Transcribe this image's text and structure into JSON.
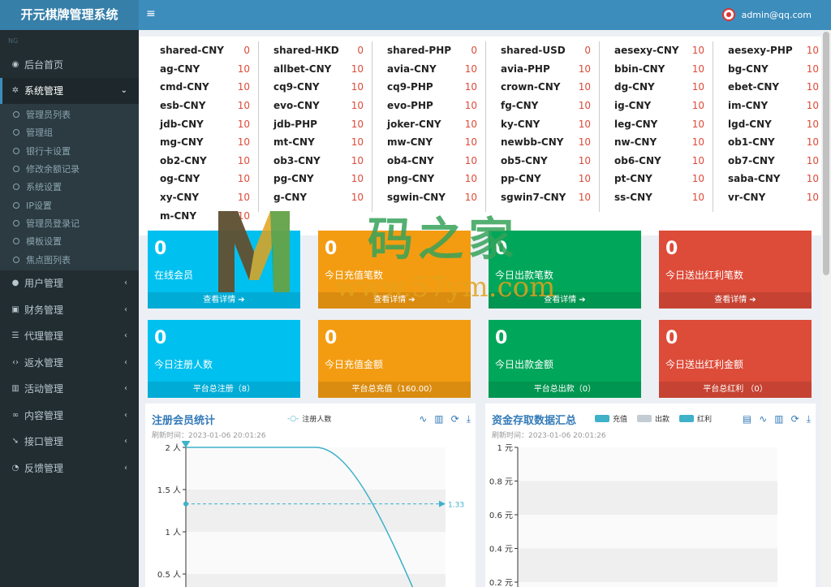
{
  "app": {
    "title": "开元棋牌管理系统",
    "menu_toggle": "≡",
    "user": "admin@qq.com"
  },
  "sidebar": {
    "header": "NG",
    "items": [
      {
        "icon": "dashboard-icon",
        "glyph": "◉",
        "label": "后台首页"
      },
      {
        "icon": "gear-icon",
        "glyph": "✲",
        "label": "系统管理",
        "caret": "⌄",
        "active": true,
        "children": [
          "管理员列表",
          "管理组",
          "银行卡设置",
          "修改余额记录",
          "系统设置",
          "IP设置",
          "管理员登录记",
          "模板设置",
          "焦点图列表"
        ]
      },
      {
        "icon": "users-icon",
        "glyph": "●",
        "label": "用户管理",
        "caret": "‹"
      },
      {
        "icon": "money-icon",
        "glyph": "▣",
        "label": "财务管理",
        "caret": "‹"
      },
      {
        "icon": "list-icon",
        "glyph": "☰",
        "label": "代理管理",
        "caret": "‹"
      },
      {
        "icon": "code-icon",
        "glyph": "‹›",
        "label": "返水管理",
        "caret": "‹"
      },
      {
        "icon": "map-icon",
        "glyph": "▥",
        "label": "活动管理",
        "caret": "‹"
      },
      {
        "icon": "link-icon",
        "glyph": "∞",
        "label": "内容管理",
        "caret": "‹"
      },
      {
        "icon": "plug-icon",
        "glyph": "➘",
        "label": "接口管理",
        "caret": "‹"
      },
      {
        "icon": "comment-icon",
        "glyph": "◔",
        "label": "反馈管理",
        "caret": "‹"
      }
    ]
  },
  "games": [
    [
      [
        "shared-CNY",
        "0"
      ],
      [
        "ag-CNY",
        "10"
      ],
      [
        "cmd-CNY",
        "10"
      ],
      [
        "esb-CNY",
        "10"
      ],
      [
        "jdb-CNY",
        "10"
      ],
      [
        "mg-CNY",
        "10"
      ],
      [
        "ob2-CNY",
        "10"
      ],
      [
        "og-CNY",
        "10"
      ],
      [
        "xy-CNY",
        "10"
      ],
      [
        "m-CNY",
        "10"
      ]
    ],
    [
      [
        "shared-HKD",
        "0"
      ],
      [
        "allbet-CNY",
        "10"
      ],
      [
        "cq9-CNY",
        "10"
      ],
      [
        "evo-CNY",
        "10"
      ],
      [
        "jdb-PHP",
        "10"
      ],
      [
        "mt-CNY",
        "10"
      ],
      [
        "ob3-CNY",
        "10"
      ],
      [
        "pg-CNY",
        "10"
      ],
      [
        "g-CNY",
        "10"
      ]
    ],
    [
      [
        "shared-PHP",
        "0"
      ],
      [
        "avia-CNY",
        "10"
      ],
      [
        "cq9-PHP",
        "10"
      ],
      [
        "evo-PHP",
        "10"
      ],
      [
        "joker-CNY",
        "10"
      ],
      [
        "mw-CNY",
        "10"
      ],
      [
        "ob4-CNY",
        "10"
      ],
      [
        "png-CNY",
        "10"
      ],
      [
        "sgwin-CNY",
        "10"
      ]
    ],
    [
      [
        "shared-USD",
        "0"
      ],
      [
        "avia-PHP",
        "10"
      ],
      [
        "crown-CNY",
        "10"
      ],
      [
        "fg-CNY",
        "10"
      ],
      [
        "ky-CNY",
        "10"
      ],
      [
        "newbb-CNY",
        "10"
      ],
      [
        "ob5-CNY",
        "10"
      ],
      [
        "pp-CNY",
        "10"
      ],
      [
        "sgwin7-CNY",
        "10"
      ]
    ],
    [
      [
        "aesexy-CNY",
        "10"
      ],
      [
        "bbin-CNY",
        "10"
      ],
      [
        "dg-CNY",
        "10"
      ],
      [
        "ig-CNY",
        "10"
      ],
      [
        "leg-CNY",
        "10"
      ],
      [
        "nw-CNY",
        "10"
      ],
      [
        "ob6-CNY",
        "10"
      ],
      [
        "pt-CNY",
        "10"
      ],
      [
        "ss-CNY",
        "10"
      ]
    ],
    [
      [
        "aesexy-PHP",
        "10"
      ],
      [
        "bg-CNY",
        "10"
      ],
      [
        "ebet-CNY",
        "10"
      ],
      [
        "im-CNY",
        "10"
      ],
      [
        "lgd-CNY",
        "10"
      ],
      [
        "ob1-CNY",
        "10"
      ],
      [
        "ob7-CNY",
        "10"
      ],
      [
        "saba-CNY",
        "10"
      ],
      [
        "vr-CNY",
        "10"
      ]
    ]
  ],
  "cards": [
    {
      "value": "0",
      "label": "在线会员",
      "footer": "查看详情",
      "footer_icon": "➔",
      "color": "aqua"
    },
    {
      "value": "0",
      "label": "今日充值笔数",
      "footer": "查看详情",
      "footer_icon": "➔",
      "color": "yellow"
    },
    {
      "value": "0",
      "label": "今日出款笔数",
      "footer": "查看详情",
      "footer_icon": "➔",
      "color": "green"
    },
    {
      "value": "0",
      "label": "今日送出红利笔数",
      "footer": "查看详情",
      "footer_icon": "➔",
      "color": "red"
    },
    {
      "value": "0",
      "label": "今日注册人数",
      "footer": "平台总注册（8）",
      "color": "aqua"
    },
    {
      "value": "0",
      "label": "今日充值金额",
      "footer": "平台总充值（160.00）",
      "color": "yellow"
    },
    {
      "value": "0",
      "label": "今日出款金额",
      "footer": "平台总出款（0）",
      "color": "green"
    },
    {
      "value": "0",
      "label": "今日送出红利金额",
      "footer": "平台总红利 （0）",
      "color": "red"
    }
  ],
  "panel_left": {
    "title": "注册会员统计",
    "refresh": "刷新时间：2023-01-06 20:01:26",
    "legend": "注册人数",
    "tools": [
      "∿",
      "▥",
      "⟳",
      "⤓"
    ],
    "pin_label": "2",
    "avg_label": "1.33",
    "yticks": [
      "2 人",
      "1.5 人",
      "1 人",
      "0.5 人"
    ]
  },
  "panel_right": {
    "title": "资金存取数据汇总",
    "refresh": "刷新时间：2023-01-06 20:01:26",
    "legend": [
      {
        "label": "充值",
        "color": "#3fb1c9"
      },
      {
        "label": "出款",
        "color": "#c4ccd3"
      },
      {
        "label": "红利",
        "color": "#3fb1c9"
      }
    ],
    "tools": [
      "▤",
      "∿",
      "▥",
      "⟳",
      "⤓"
    ],
    "yticks": [
      "1 元",
      "0.8 元",
      "0.6 元",
      "0.4 元",
      "0.2 元"
    ]
  },
  "chart_data": [
    {
      "type": "line",
      "title": "注册会员统计",
      "series": [
        {
          "name": "注册人数",
          "values": [
            2,
            2,
            2,
            0
          ]
        }
      ],
      "mark_point": {
        "label": "2",
        "value": 2
      },
      "mark_line": {
        "label": "1.33",
        "value": 1.33
      },
      "ylim": [
        0,
        2
      ],
      "y_ticks": [
        "2 人",
        "1.5 人",
        "1 人",
        "0.5 人"
      ],
      "grid": true
    },
    {
      "type": "bar",
      "title": "资金存取数据汇总",
      "series": [
        {
          "name": "充值",
          "values": []
        },
        {
          "name": "出款",
          "values": []
        },
        {
          "name": "红利",
          "values": []
        }
      ],
      "ylim": [
        0,
        1
      ],
      "y_ticks": [
        "1 元",
        "0.8 元",
        "0.6 元",
        "0.4 元",
        "0.2 元"
      ],
      "legend": "top"
    }
  ],
  "watermark": {
    "text": "码之家",
    "url": "www.57ym.com",
    "logo": "M"
  }
}
